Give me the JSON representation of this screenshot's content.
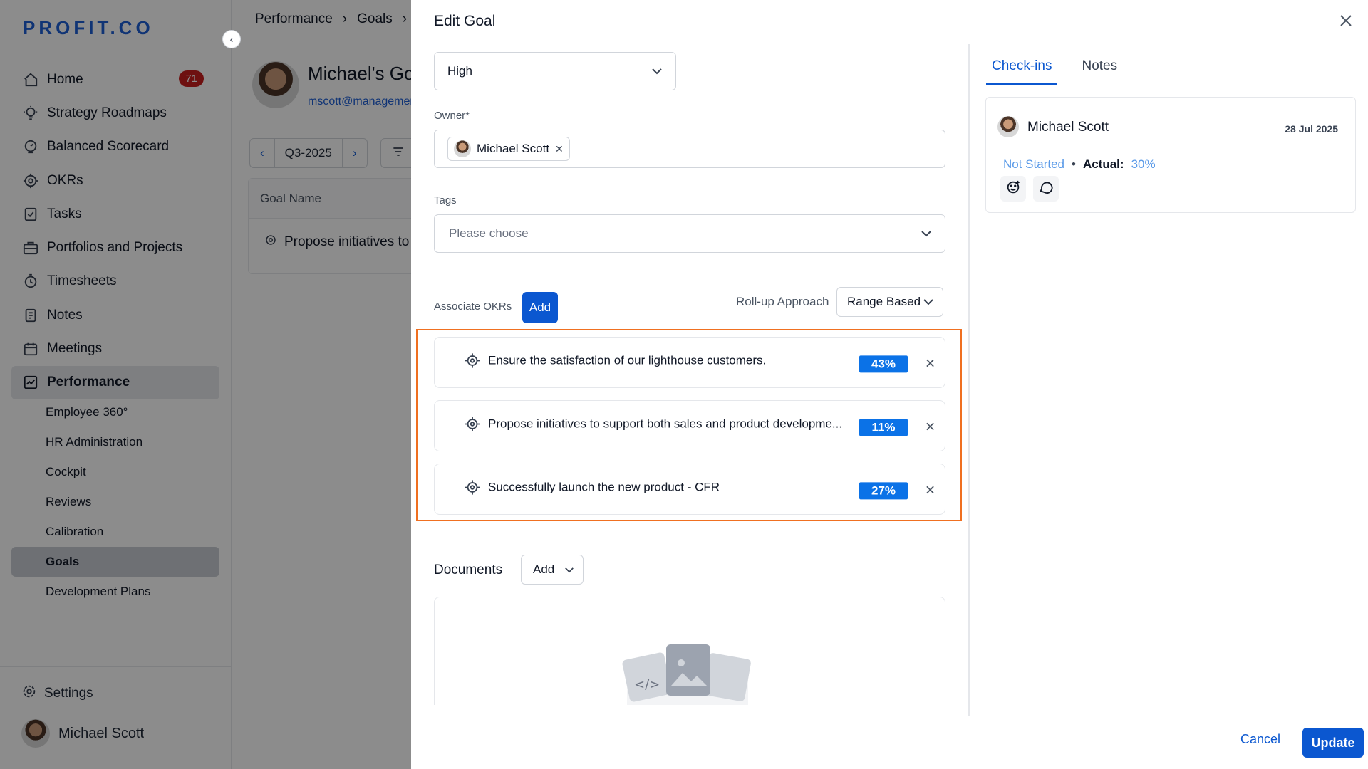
{
  "app": {
    "logo": "PROFIT.CO",
    "nav": [
      {
        "label": "Home",
        "icon": "home-icon",
        "badge": "71"
      },
      {
        "label": "Strategy Roadmaps",
        "icon": "bulb-icon"
      },
      {
        "label": "Balanced Scorecard",
        "icon": "scorecard-icon"
      },
      {
        "label": "OKRs",
        "icon": "target-icon"
      },
      {
        "label": "Tasks",
        "icon": "tasks-icon"
      },
      {
        "label": "Portfolios and Projects",
        "icon": "briefcase-icon"
      },
      {
        "label": "Timesheets",
        "icon": "timer-icon"
      },
      {
        "label": "Notes",
        "icon": "notes-icon"
      },
      {
        "label": "Meetings",
        "icon": "calendar-icon"
      },
      {
        "label": "Performance",
        "icon": "performance-icon",
        "active": true
      }
    ],
    "subnav": [
      {
        "label": "Employee 360°"
      },
      {
        "label": "HR Administration"
      },
      {
        "label": "Cockpit"
      },
      {
        "label": "Reviews"
      },
      {
        "label": "Calibration"
      },
      {
        "label": "Goals",
        "active": true
      },
      {
        "label": "Development Plans"
      }
    ],
    "settings_label": "Settings",
    "user_name": "Michael Scott"
  },
  "page": {
    "breadcrumb": [
      "Performance",
      "›",
      "Goals",
      "›"
    ],
    "title": "Michael's Go",
    "email": "mscott@managemen",
    "period": "Q3-2025",
    "table_header": "Goal Name",
    "table_row": "Propose initiatives to s"
  },
  "drawer": {
    "title": "Edit Goal",
    "priority_value": "High",
    "owner_label": "Owner*",
    "owner_chip": "Michael Scott",
    "tags_label": "Tags",
    "tags_placeholder": "Please choose",
    "associate_label": "Associate OKRs",
    "associate_add": "Add",
    "rollup_label": "Roll-up Approach",
    "rollup_value": "Range Based",
    "okrs": [
      {
        "text": "Ensure the satisfaction of our lighthouse customers.",
        "progress": "43%"
      },
      {
        "text": "Propose initiatives to support both sales and product developme...",
        "progress": "11%"
      },
      {
        "text": "Successfully launch the new product - CFR",
        "progress": "27%"
      }
    ],
    "documents_label": "Documents",
    "documents_add": "Add",
    "tabs": [
      "Check-ins",
      "Notes"
    ],
    "checkin": {
      "name": "Michael Scott",
      "date": "28 Jul 2025",
      "status": "Not Started",
      "bullet": "•",
      "actual_label": "Actual:",
      "actual_value": "30%"
    },
    "cancel_label": "Cancel",
    "update_label": "Update"
  },
  "colors": {
    "primary": "#0b57d0",
    "progress": "#0b72e7",
    "highlight": "#f07021",
    "badge": "#c81e1e",
    "status": "#5a9ae8"
  }
}
